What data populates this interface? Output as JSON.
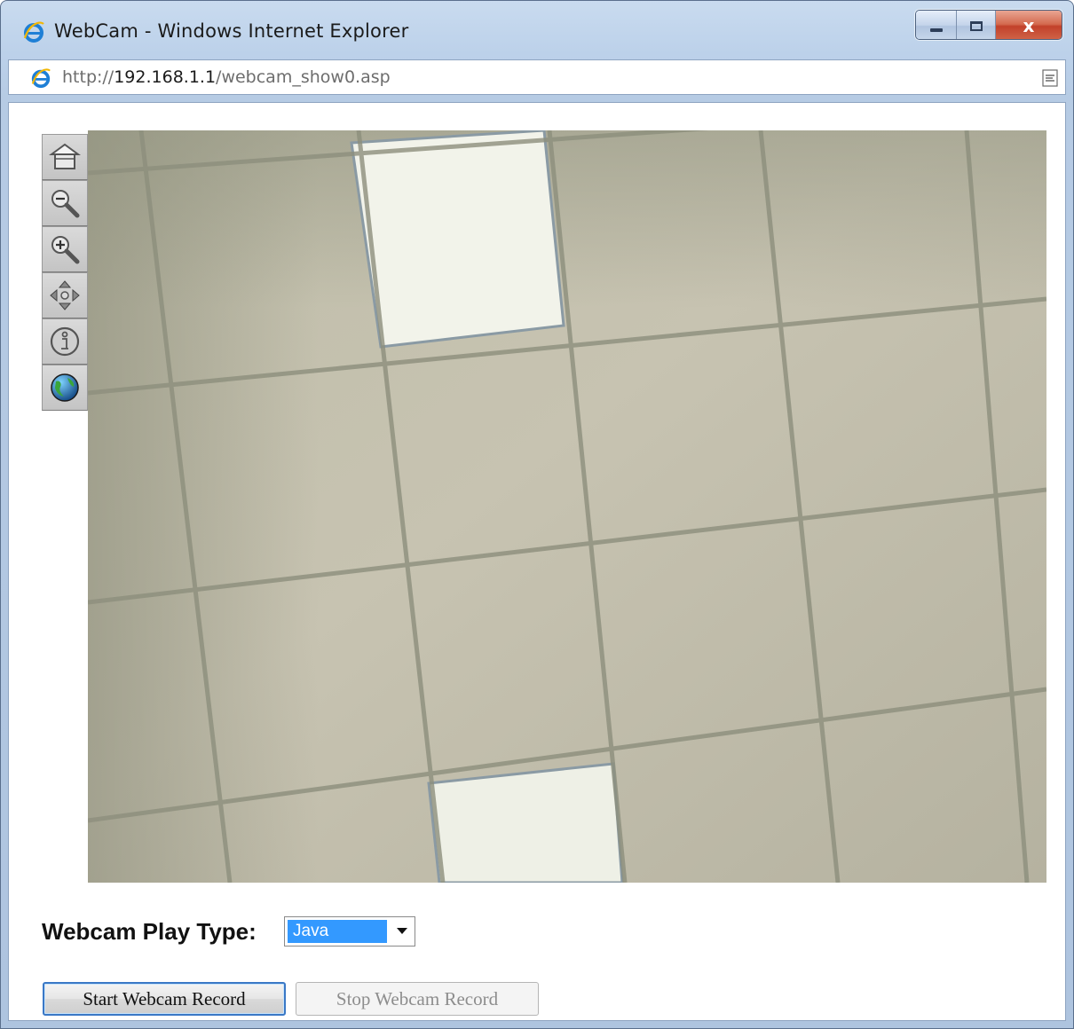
{
  "window": {
    "title": "WebCam - Windows Internet Explorer",
    "controls": {
      "close_glyph": "x"
    }
  },
  "address_bar": {
    "url_prefix": "http://",
    "url_host": "192.168.1.1",
    "url_path": "/webcam_show0.asp"
  },
  "toolbar": {
    "items": [
      {
        "name": "home",
        "icon": "home-icon"
      },
      {
        "name": "zoom-out",
        "icon": "zoom-out-icon"
      },
      {
        "name": "zoom-in",
        "icon": "zoom-in-icon"
      },
      {
        "name": "pan",
        "icon": "move-icon"
      },
      {
        "name": "info",
        "icon": "info-icon"
      },
      {
        "name": "globe",
        "icon": "globe-icon"
      }
    ]
  },
  "webcam": {
    "image": "ceiling-tiles-with-lights"
  },
  "play_type": {
    "label": "Webcam Play Type:",
    "selected": "Java"
  },
  "buttons": {
    "start_label": "Start Webcam Record",
    "stop_label": "Stop Webcam Record"
  },
  "colors": {
    "selection": "#3399ff",
    "frame": "#bcd1ea",
    "close_button": "#c2412a"
  }
}
